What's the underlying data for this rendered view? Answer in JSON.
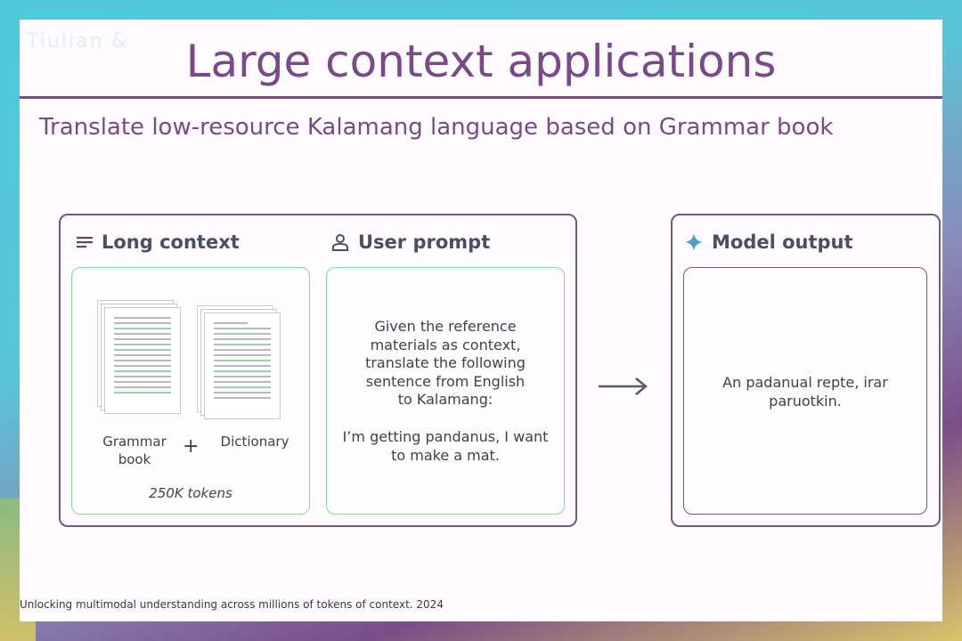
{
  "watermark": "Tiulian &",
  "title": "Large context applications",
  "subtitle": "Translate low-resource Kalamang language based on Grammar book",
  "long_context": {
    "header": "Long context",
    "icon": "text-lines-icon",
    "grammar_label_1": "Grammar",
    "grammar_label_2": "book",
    "plus": "+",
    "dictionary_label": "Dictionary",
    "tokens": "250K tokens"
  },
  "user_prompt": {
    "header": "User prompt",
    "icon": "person-icon",
    "lines": [
      "Given the reference",
      "materials as context,",
      "translate the following",
      "sentence from English",
      "to Kalamang:"
    ],
    "sentence_lines": [
      "I’m getting pandanus, I want",
      "to make a mat."
    ]
  },
  "model_output": {
    "header": "Model output",
    "icon": "sparkle-icon",
    "lines": [
      "An padanual repte, irar",
      "paruotkin."
    ]
  },
  "footer": "Unlocking multimodal understanding across millions of tokens of context. 2024",
  "colors": {
    "title": "#7a4a86",
    "panel_border": "#6f5a86",
    "inner_border": "#8fd49c",
    "sparkle": "#4aa3c8"
  }
}
